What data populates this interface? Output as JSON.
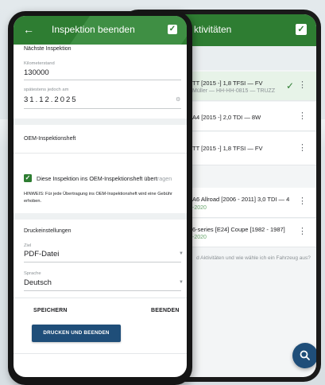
{
  "back_app": {
    "title": "ktivitäten",
    "vehicles": [
      {
        "line1": "TT [2015 -] 1,8 TFSI — FV",
        "line2": "Müller — HH-HH-0815 — TRUZZ"
      },
      {
        "line1": "A4 [2015 -] 2,0 TDI — 8W",
        "line2": ""
      },
      {
        "line1": "TT [2015 -] 1,8 TFSI — FV",
        "line2": ""
      },
      {
        "line1": "A6 Allroad [2006 - 2011] 3,0 TDI — 4",
        "line2": "-2020"
      },
      {
        "line1": "6-series [E24] Coupe [1982 - 1987]",
        "line2": "-2020"
      }
    ],
    "help_text": "d Aktivitäten und wie wähle ich ein Fahrzeug aus?"
  },
  "front_app": {
    "title": "Inspektion beenden",
    "next_inspection_heading": "Nächste Inspektion",
    "mileage_label": "Kilometerstand",
    "mileage_value": "130000",
    "date_label": "spätestens jedoch am",
    "date_value": "31.12.2025",
    "oem_heading": "OEM-Inspektionsheft",
    "oem_checkbox_label": "Diese Inspektion ins OEM-Inspektionsheft übert",
    "oem_checkbox_label_fade": "ragen",
    "oem_checkbox_checked": true,
    "hint_text": "HINWEIS: Für jede Übertragung ins OEM-Inspektionsheft wird eine Gebühr erhoben.",
    "print_heading": "Druckeinstellungen",
    "target_label": "Ziel",
    "target_value": "PDF-Datei",
    "language_label": "Sprache",
    "language_value": "Deutsch",
    "save_label": "SPEICHERN",
    "finish_label": "BEENDEN",
    "print_finish_label": "DRUCKEN UND BEENDEN"
  },
  "colors": {
    "header_green": "#2e7d32",
    "primary_blue": "#1f4e79",
    "selected_row": "#e7f3e8"
  },
  "icons": {
    "back": "arrow-left-icon",
    "confirm": "check-square-icon",
    "menu": "more-vert-icon",
    "search": "search-icon",
    "dropdown": "chevron-down-icon",
    "calendar": "gear-icon"
  }
}
